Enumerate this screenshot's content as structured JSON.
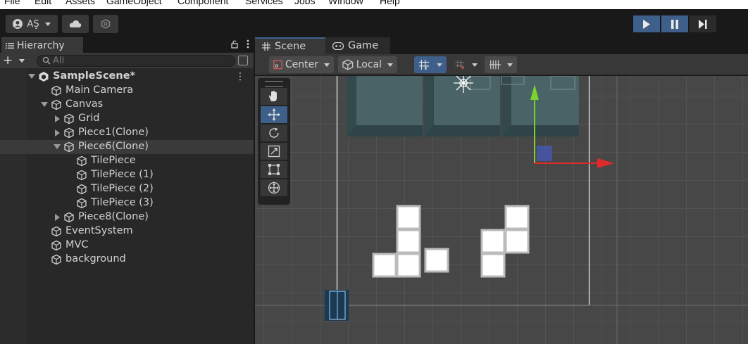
{
  "menu": [
    "File",
    "Edit",
    "Assets",
    "GameObject",
    "Component",
    "Services",
    "Jobs",
    "Window",
    "Help"
  ],
  "toolbar": {
    "account_label": "AŞ",
    "cloud_icon": "cloud-icon",
    "collab_icon": "collab-icon",
    "play_icon": "play-icon",
    "pause_icon": "pause-icon",
    "step_icon": "step-icon",
    "accent": "#3d5f8a"
  },
  "hierarchy": {
    "tab_label": "Hierarchy",
    "add_label": "+",
    "search_placeholder": "All",
    "items": [
      {
        "label": "SampleScene*",
        "depth": 0,
        "fold": "open",
        "scene": true
      },
      {
        "label": "Main Camera",
        "depth": 1,
        "fold": "none"
      },
      {
        "label": "Canvas",
        "depth": 1,
        "fold": "open"
      },
      {
        "label": "Grid",
        "depth": 2,
        "fold": "closed"
      },
      {
        "label": "Piece1(Clone)",
        "depth": 2,
        "fold": "closed"
      },
      {
        "label": "Piece6(Clone)",
        "depth": 2,
        "fold": "open",
        "selected": true
      },
      {
        "label": "TilePiece",
        "depth": 3,
        "fold": "none"
      },
      {
        "label": "TilePiece (1)",
        "depth": 3,
        "fold": "none"
      },
      {
        "label": "TilePiece (2)",
        "depth": 3,
        "fold": "none"
      },
      {
        "label": "TilePiece (3)",
        "depth": 3,
        "fold": "none"
      },
      {
        "label": "Piece8(Clone)",
        "depth": 2,
        "fold": "closed"
      },
      {
        "label": "EventSystem",
        "depth": 1,
        "fold": "none"
      },
      {
        "label": "MVC",
        "depth": 1,
        "fold": "none"
      },
      {
        "label": "background",
        "depth": 1,
        "fold": "none"
      }
    ]
  },
  "scene": {
    "tab_scene": "Scene",
    "tab_game": "Game",
    "pivot_label": "Center",
    "space_label": "Local"
  }
}
